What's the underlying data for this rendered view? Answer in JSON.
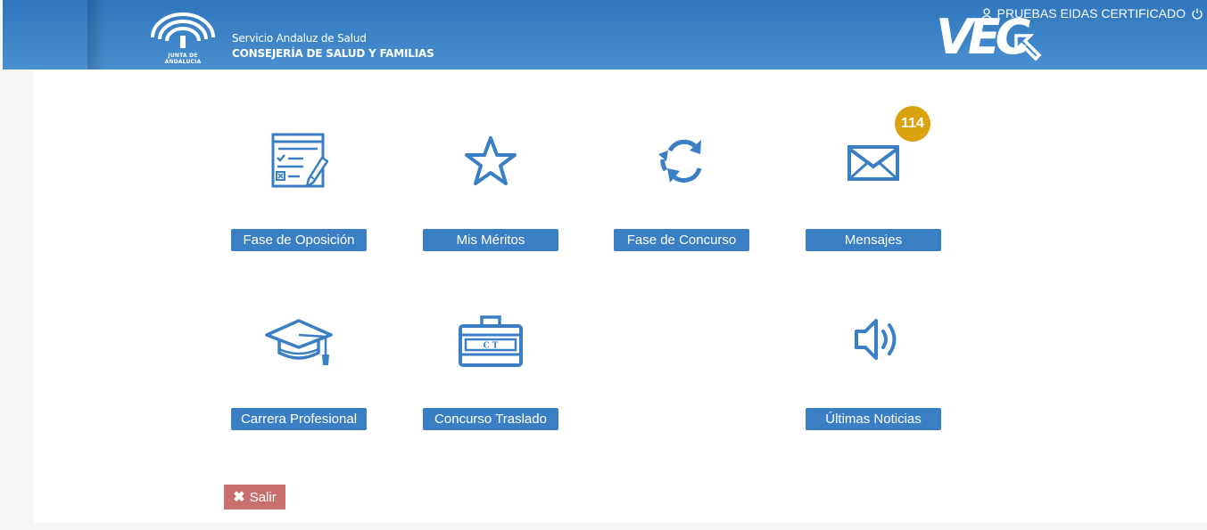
{
  "header": {
    "org_line1": "Servicio Andaluz de Salud",
    "org_line2": "CONSEJERÍA DE SALUD Y FAMILIAS",
    "emblem_text": "JUNTA DE ANDALUCIA",
    "user_name": "PRUEBAS EIDAS CERTIFICADO",
    "app_logo": "VEC",
    "icons": [
      "user-icon",
      "power-icon",
      "junta-emblem"
    ]
  },
  "tiles": [
    {
      "label": "Fase de Oposición",
      "icon": "exam-form-icon"
    },
    {
      "label": "Mis Méritos",
      "icon": "star-icon"
    },
    {
      "label": "Fase de Concurso",
      "icon": "refresh-icon"
    },
    {
      "label": "Mensajes",
      "icon": "envelope-icon",
      "badge": "114"
    },
    {
      "label": "Carrera Profesional",
      "icon": "graduation-cap-icon"
    },
    {
      "label": "Concurso Traslado",
      "icon": "briefcase-icon"
    },
    {
      "label": "Últimas Noticias",
      "icon": "speaker-icon"
    }
  ],
  "salir": {
    "label": "Salir",
    "icon": "close-icon"
  },
  "colors": {
    "header": "#3d84c7",
    "button": "#3a7ec4",
    "icon": "#3a7ec4",
    "badge": "#dba20f",
    "salir": "#c9706e"
  }
}
